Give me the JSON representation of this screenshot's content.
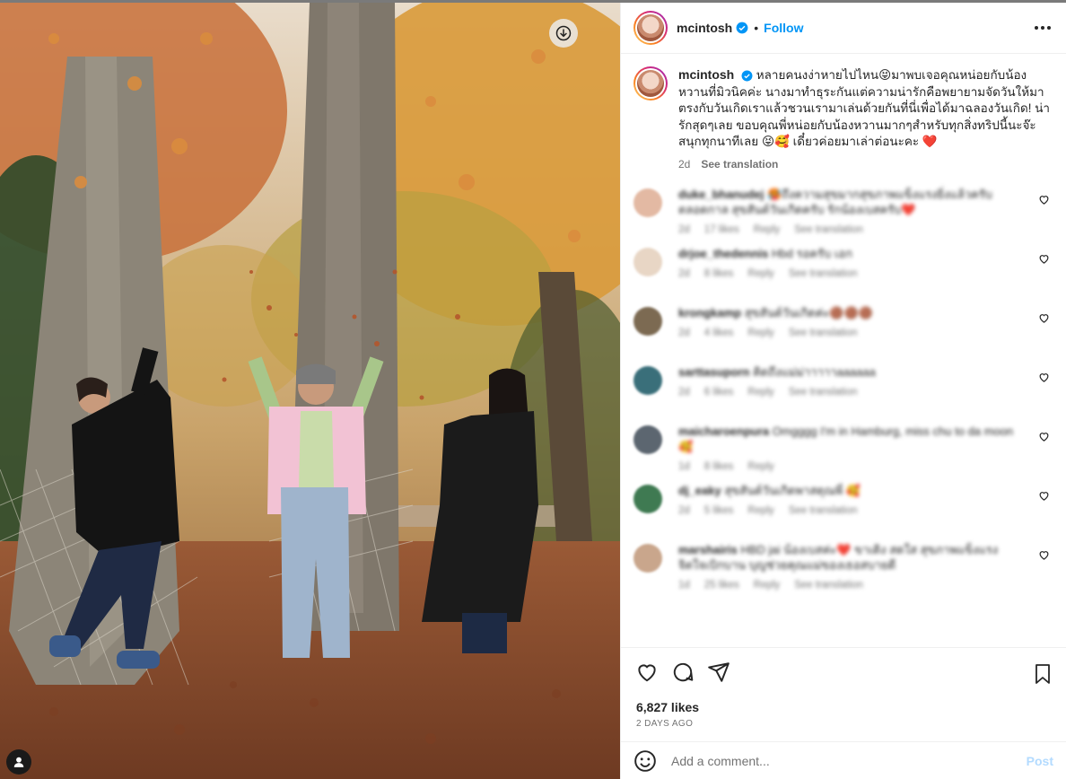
{
  "post": {
    "username": "mcintosh",
    "follow_label": "Follow",
    "caption": "หลายคนงง่าหายไปไหน😝มาพบเจอคุณหน่อยกับน้องหวานที่มิวนิคค่ะ นางมาทำธุระกันแต่ความน่ารักคือพยายามจัดวันให้มาตรงกับวันเกิดเราแล้วชวนเรามาเล่นด้วยกันที่นี่เพื่อได้มาฉลองวันเกิด! น่ารักสุดๆเลย ขอบคุณพี่หน่อยกับน้องหวานมากๆสำหรับทุกสิ่งทริปนี้นะจ๊ะ สนุกทุกนาทีเลย 😝🥰 เดี๋ยวค่อยมาเล่าต่อนะคะ ❤️",
    "caption_age": "2d",
    "see_translation": "See translation",
    "likes": "6,827 likes",
    "date": "2 DAYS AGO",
    "add_comment_placeholder": "Add a comment...",
    "post_label": "Post"
  },
  "comments": [
    {
      "user": "duke_bhanudej",
      "text": "🥵ถึงความสุขมากสุขภาพแข็งแรงยิ่งแล้วครับ ตลอดกาล สุขสันต์วันเกิดครับ รักน้องเบสครับ❤️",
      "age": "2d",
      "likes": "17 likes",
      "reply": "Reply",
      "translate": "See translation",
      "color": "#e3b9a3"
    },
    {
      "user": "drjoe_thedennis",
      "text": "Hbd รอครับ เอก",
      "age": "2d",
      "likes": "8 likes",
      "reply": "Reply",
      "translate": "See translation",
      "color": "#e8d6c5"
    },
    {
      "user": "krongkamp",
      "text": "สุขสันต์วันเกิดค่ะ🟤🟤🟤",
      "age": "2d",
      "likes": "4 likes",
      "reply": "Reply",
      "translate": "See translation",
      "color": "#7c6a52"
    },
    {
      "user": "sarttasuporn",
      "text": "คิดถึงแม่ม่าาาาาaaaaaa",
      "age": "2d",
      "likes": "6 likes",
      "reply": "Reply",
      "translate": "See translation",
      "color": "#3a6f7a"
    },
    {
      "user": "maicharoenpura",
      "text": "Omgggg I'm in Hamburg, miss chu to da moon🥰",
      "age": "1d",
      "likes": "8 likes",
      "reply": "Reply",
      "translate": "",
      "color": "#5c6670"
    },
    {
      "user": "dj_eaky",
      "text": "สุขสันต์วันเกิดพาสตุณพี่ 🥰",
      "age": "2d",
      "likes": "5 likes",
      "reply": "Reply",
      "translate": "See translation",
      "color": "#3f7a52"
    },
    {
      "user": "marshairis",
      "text": "HBD jai น้องเบสค่ะ❤️ ขาเดิง สดใส สุขภาพแข็งแรงจิตใจเบิกบาน บุญช่วยคุณแม่ของเธอสบายดี",
      "age": "1d",
      "likes": "25 likes",
      "reply": "Reply",
      "translate": "See translation",
      "color": "#c9a68c"
    }
  ],
  "icons": {
    "download": "download-icon",
    "tag": "user-tag-icon",
    "more": "more-options-icon",
    "heart": "heart-icon",
    "comment": "comment-icon",
    "share": "share-icon",
    "save": "bookmark-icon",
    "emoji": "emoji-icon",
    "verified": "verified-badge-icon"
  },
  "colors": {
    "accent": "#0095f6",
    "muted": "#737373"
  }
}
